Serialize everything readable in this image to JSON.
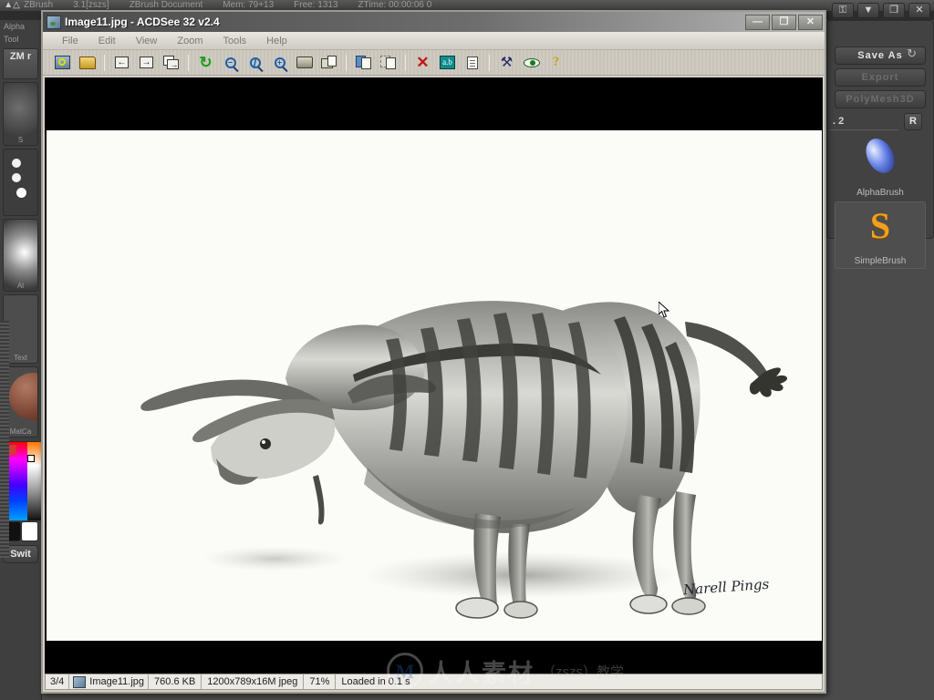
{
  "zbrush": {
    "logo_icon": "zbrush-runner-icon",
    "titlebar_items": [
      "ZBrush",
      "3.1[zszs]",
      "ZBrush Document",
      "Mem: 79+13",
      "Free: 1313",
      "ZTime: 00:00:06 0"
    ],
    "menu_highlight_label": "",
    "window_controls": [
      {
        "name": "lock-button",
        "glyph": "⚿"
      },
      {
        "name": "minimize-button",
        "glyph": "▼"
      },
      {
        "name": "restore-button",
        "glyph": "❐"
      },
      {
        "name": "close-button",
        "glyph": "✕"
      }
    ],
    "left_sidebar": {
      "labels": [
        "Alpha",
        "Tool"
      ],
      "tool_button": "ZM\nr",
      "swatch_captions": [
        "S",
        "",
        "Al",
        "Text",
        "MatCa"
      ],
      "switch_button": "Swit"
    },
    "right_sidebar": {
      "refresh_icon": "refresh-icon",
      "buttons": [
        {
          "label": "Save As",
          "state": "enabled"
        },
        {
          "label": "Export",
          "state": "disabled"
        },
        {
          "label": "PolyMesh3D",
          "state": "disabled"
        }
      ],
      "subtool_label": ". 2",
      "r_button": "R",
      "brushes": [
        {
          "label": "AlphaBrush",
          "selected": false
        },
        {
          "label": "SimpleBrush",
          "selected": true
        }
      ]
    }
  },
  "acdsee": {
    "window_title": "Image11.jpg - ACDSee 32 v2.4",
    "title_icon": "image-file-icon",
    "window_controls": [
      {
        "name": "minimize-button",
        "glyph": "—"
      },
      {
        "name": "maximize-button",
        "glyph": "❐"
      },
      {
        "name": "close-button",
        "glyph": "✕"
      }
    ],
    "menus": [
      "File",
      "Edit",
      "View",
      "Zoom",
      "Tools",
      "Help"
    ],
    "toolbar": [
      {
        "name": "browse-icon",
        "glyph": "🔍",
        "type": "browse"
      },
      {
        "name": "open-folder-icon",
        "glyph": "📂",
        "type": "open"
      },
      {
        "type": "sep"
      },
      {
        "name": "previous-image-icon",
        "glyph": "←",
        "type": "box"
      },
      {
        "name": "next-image-icon",
        "glyph": "→",
        "type": "box"
      },
      {
        "name": "slideshow-icon",
        "glyph": "→",
        "type": "stack"
      },
      {
        "type": "sep"
      },
      {
        "name": "rotate-refresh-icon",
        "glyph": "↻",
        "type": "green"
      },
      {
        "name": "zoom-out-icon",
        "glyph": "−",
        "type": "mag"
      },
      {
        "name": "zoom-actual-icon",
        "glyph": "",
        "type": "mag"
      },
      {
        "name": "zoom-in-icon",
        "glyph": "+",
        "type": "mag"
      },
      {
        "name": "print-icon",
        "glyph": "🖶",
        "type": "print"
      },
      {
        "name": "print-preview-icon",
        "glyph": "🗎",
        "type": "preview"
      },
      {
        "type": "sep"
      },
      {
        "name": "copy-icon",
        "glyph": "⧉",
        "type": "copy"
      },
      {
        "name": "paste-icon",
        "glyph": "⧉",
        "type": "paste"
      },
      {
        "type": "sep"
      },
      {
        "name": "delete-icon",
        "glyph": "✕",
        "type": "delete"
      },
      {
        "name": "rename-icon",
        "glyph": "a.b",
        "type": "rename"
      },
      {
        "name": "properties-icon",
        "glyph": "",
        "type": "doc"
      },
      {
        "type": "sep"
      },
      {
        "name": "edit-tools-icon",
        "glyph": "⚒",
        "type": "tools"
      },
      {
        "name": "view-icon",
        "glyph": "👁",
        "type": "eye"
      },
      {
        "name": "help-icon",
        "glyph": "?",
        "type": "help"
      }
    ],
    "statusbar": {
      "index": "3/4",
      "thumb_icon": "image-thumbnail-icon",
      "filename": "Image11.jpg",
      "filesize": "760.6 KB",
      "dimensions": "1200x789x16M jpeg",
      "zoom": "71%",
      "load_time": "Loaded in 0.1 s"
    },
    "image": {
      "signature": "Narell Pings",
      "alt": "pencil drawing of a horned striped quadruped creature"
    }
  },
  "watermark": {
    "logo": "rr-logo-icon",
    "text": "人人素材",
    "subtext": "（zszs）教学"
  },
  "colors": {
    "zbrush_bg": "#4b4b4b",
    "zbrush_accent": "#f09a36",
    "acdsee_chrome": "#d4d0c8",
    "viewer_bg": "#000000",
    "image_bg": "#fbfcf7"
  }
}
